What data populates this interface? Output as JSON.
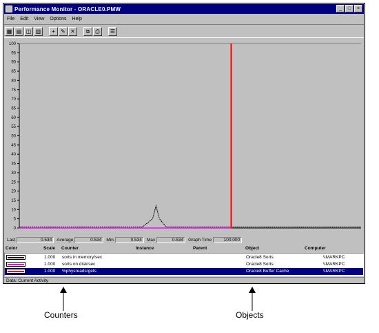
{
  "window": {
    "title": "Performance Monitor - ORACLE0.PMW",
    "controls": [
      "_",
      "□",
      "×"
    ]
  },
  "menu": [
    "File",
    "Edit",
    "View",
    "Options",
    "Help"
  ],
  "toolbar": {
    "icons": [
      "chart-view-icon",
      "alert-view-icon",
      "log-view-icon",
      "report-view-icon",
      "add-counter-icon",
      "edit-counter-icon",
      "delete-counter-icon",
      "update-now-icon",
      "bookmark-icon",
      "options-icon"
    ],
    "glyphs": [
      "▦",
      "▤",
      "◫",
      "▥",
      "+",
      "✎",
      "✕",
      "⧉",
      "⎙",
      "☰"
    ]
  },
  "chart_data": {
    "type": "line",
    "ylim": [
      0,
      100
    ],
    "yticks": [
      0,
      5,
      10,
      15,
      20,
      25,
      30,
      35,
      40,
      45,
      50,
      55,
      60,
      65,
      70,
      75,
      80,
      85,
      90,
      95,
      100
    ],
    "series": [
      {
        "color": "#000000",
        "dashed": true,
        "x": [
          0,
          5,
          10,
          15,
          20,
          25,
          30,
          36,
          39,
          40,
          41,
          43,
          45,
          50,
          55,
          60,
          61,
          62,
          70,
          75,
          80,
          85,
          90,
          95,
          100
        ],
        "y": [
          0.5,
          0.5,
          0.5,
          0.5,
          0.5,
          0.5,
          0.5,
          0.5,
          5,
          12,
          5,
          0.5,
          0.5,
          0.5,
          0.5,
          0.5,
          0.5,
          0.5,
          0.5,
          0.5,
          0.5,
          0.5,
          0.5,
          0.5,
          0.5
        ]
      },
      {
        "color": "#ff00ff",
        "x": [
          0,
          52,
          62
        ],
        "y": [
          0,
          0,
          0
        ]
      }
    ],
    "time_marker": 62,
    "grid": true
  },
  "stats": {
    "last_label": "Last",
    "last_value": "0.534",
    "average_label": "Average",
    "average_value": "0.534",
    "min_label": "Min",
    "min_value": "0.534",
    "max_label": "Max",
    "max_value": "0.534",
    "graph_time_label": "Graph Time",
    "graph_time_value": "100.000"
  },
  "legend": {
    "headers": {
      "color": "Color",
      "scale": "Scale",
      "counter": "Counter",
      "instance": "Instance",
      "parent": "Parent",
      "object": "Object",
      "computer": "Computer"
    },
    "rows": [
      {
        "color": "#000000",
        "scale": "1.000",
        "counter": "sorts in memory/sec",
        "instance": "",
        "parent": "",
        "object": "Oracle8 Sorts",
        "computer": "\\\\MARKPC"
      },
      {
        "color": "#ff00ff",
        "scale": "1.000",
        "counter": "sorts on disk/sec",
        "instance": "",
        "parent": "",
        "object": "Oracle8 Sorts",
        "computer": "\\\\MARKPC"
      },
      {
        "color": "#ff0000",
        "scale": "1.000",
        "counter": "%physreads/gets",
        "instance": "",
        "parent": "",
        "object": "Oracle8 Buffer Cache",
        "computer": "\\\\MARKPC"
      }
    ],
    "selected_index": 2
  },
  "status": "Data: Current Activity",
  "callouts": {
    "counters": "Counters",
    "objects": "Objects"
  }
}
